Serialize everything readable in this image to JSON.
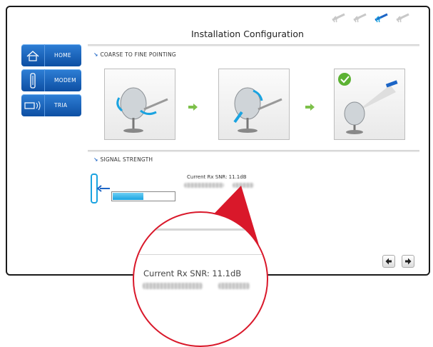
{
  "header": {
    "title": "Installation Configuration"
  },
  "nav": [
    {
      "label": "HOME",
      "icon": "home-icon"
    },
    {
      "label": "MODEM",
      "icon": "modem-icon"
    },
    {
      "label": "TRIA",
      "icon": "tria-icon"
    }
  ],
  "sections": {
    "pointing": {
      "label": "COARSE TO FINE POINTING"
    },
    "signal": {
      "label": "SIGNAL STRENGTH"
    }
  },
  "signal": {
    "snr_text": "Current Rx SNR:  11.1dB",
    "zoom_snr_text": "Current Rx SNR:  11.1dB",
    "level_fraction": 0.5
  },
  "colors": {
    "accent": "#1c65c6",
    "callout": "#d9182a",
    "bar": "#1aa3e0",
    "step_arrow": "#7dc04a"
  }
}
